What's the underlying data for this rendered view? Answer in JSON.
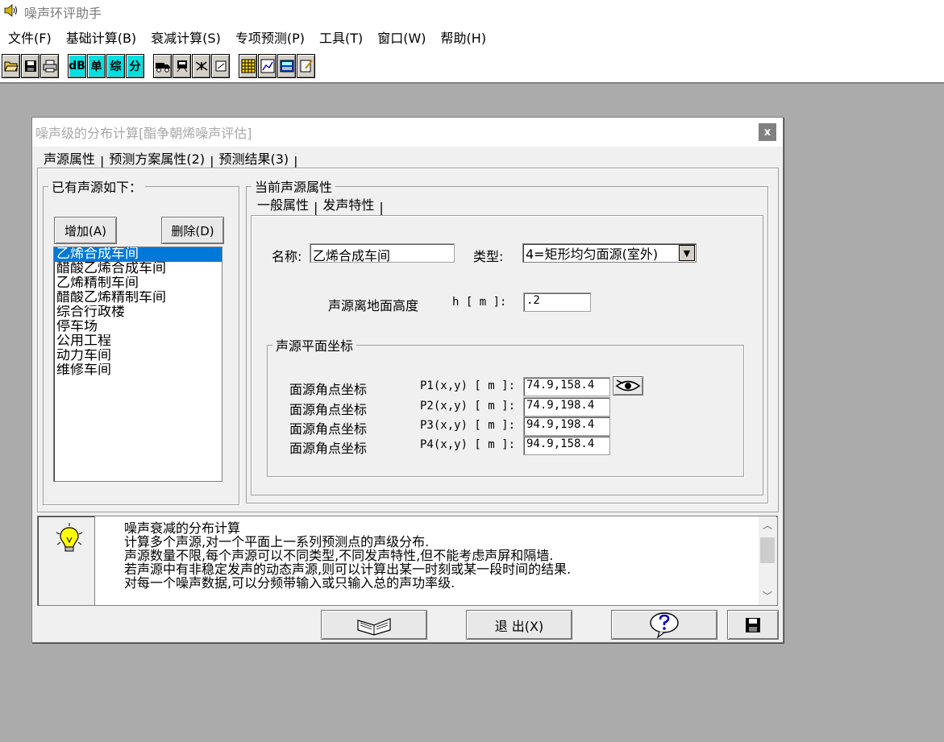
{
  "app": {
    "title": "噪声环评助手"
  },
  "menu": [
    "文件(F)",
    "基础计算(B)",
    "衰减计算(S)",
    "专项预测(P)",
    "工具(T)",
    "窗口(W)",
    "帮助(H)"
  ],
  "toolbar": {
    "text_buttons": {
      "db": "dB",
      "single": "单",
      "comp": "综",
      "split": "分"
    }
  },
  "dialog": {
    "title": "噪声级的分布计算[酯争朝烯噪声评估]",
    "close": "x",
    "tabs": [
      "声源属性",
      "预测方案属性(2)",
      "预测结果(3)"
    ],
    "tab_separator": "|",
    "sources": {
      "legend": "已有声源如下：",
      "add_label": "增加(A)",
      "delete_label": "删除(D)",
      "items": [
        "乙烯合成车间",
        "醋酸乙烯合成车间",
        "乙烯精制车间",
        "醋酸乙烯精制车间",
        "综合行政楼",
        "停车场",
        "公用工程",
        "动力车间",
        "维修车间"
      ]
    },
    "current": {
      "legend": "当前声源属性",
      "subtabs": [
        "一般属性",
        "发声特性"
      ],
      "name_label": "名称:",
      "name_value": "乙烯合成车间",
      "type_label": "类型:",
      "type_value": "4=矩形均匀面源(室外)",
      "height_label": "声源离地面高度",
      "height_unit": "h [ m ]:",
      "height_value": ".2",
      "coords": {
        "legend": "声源平面坐标",
        "rows": [
          {
            "label": "面源角点坐标",
            "key": "P1(x,y) [ m ]:",
            "value": "74.9,158.4"
          },
          {
            "label": "面源角点坐标",
            "key": "P2(x,y) [ m ]:",
            "value": "74.9,198.4"
          },
          {
            "label": "面源角点坐标",
            "key": "P3(x,y) [ m ]:",
            "value": "94.9,198.4"
          },
          {
            "label": "面源角点坐标",
            "key": "P4(x,y) [ m ]:",
            "value": "94.9,158.4"
          }
        ]
      }
    },
    "help": {
      "lines": [
        "噪声衰减的分布计算",
        "计算多个声源,对一个平面上一系列预测点的声级分布.",
        "声源数量不限,每个声源可以不同类型,不同发声特性,但不能考虑声屏和隔墙.",
        "若声源中有非稳定发声的动态声源,则可以计算出某一时刻或某一段时间的结果.",
        "对每一个噪声数据,可以分频带输入或只输入总的声功率级."
      ]
    },
    "buttons": {
      "exit": "退 出(X)"
    }
  }
}
